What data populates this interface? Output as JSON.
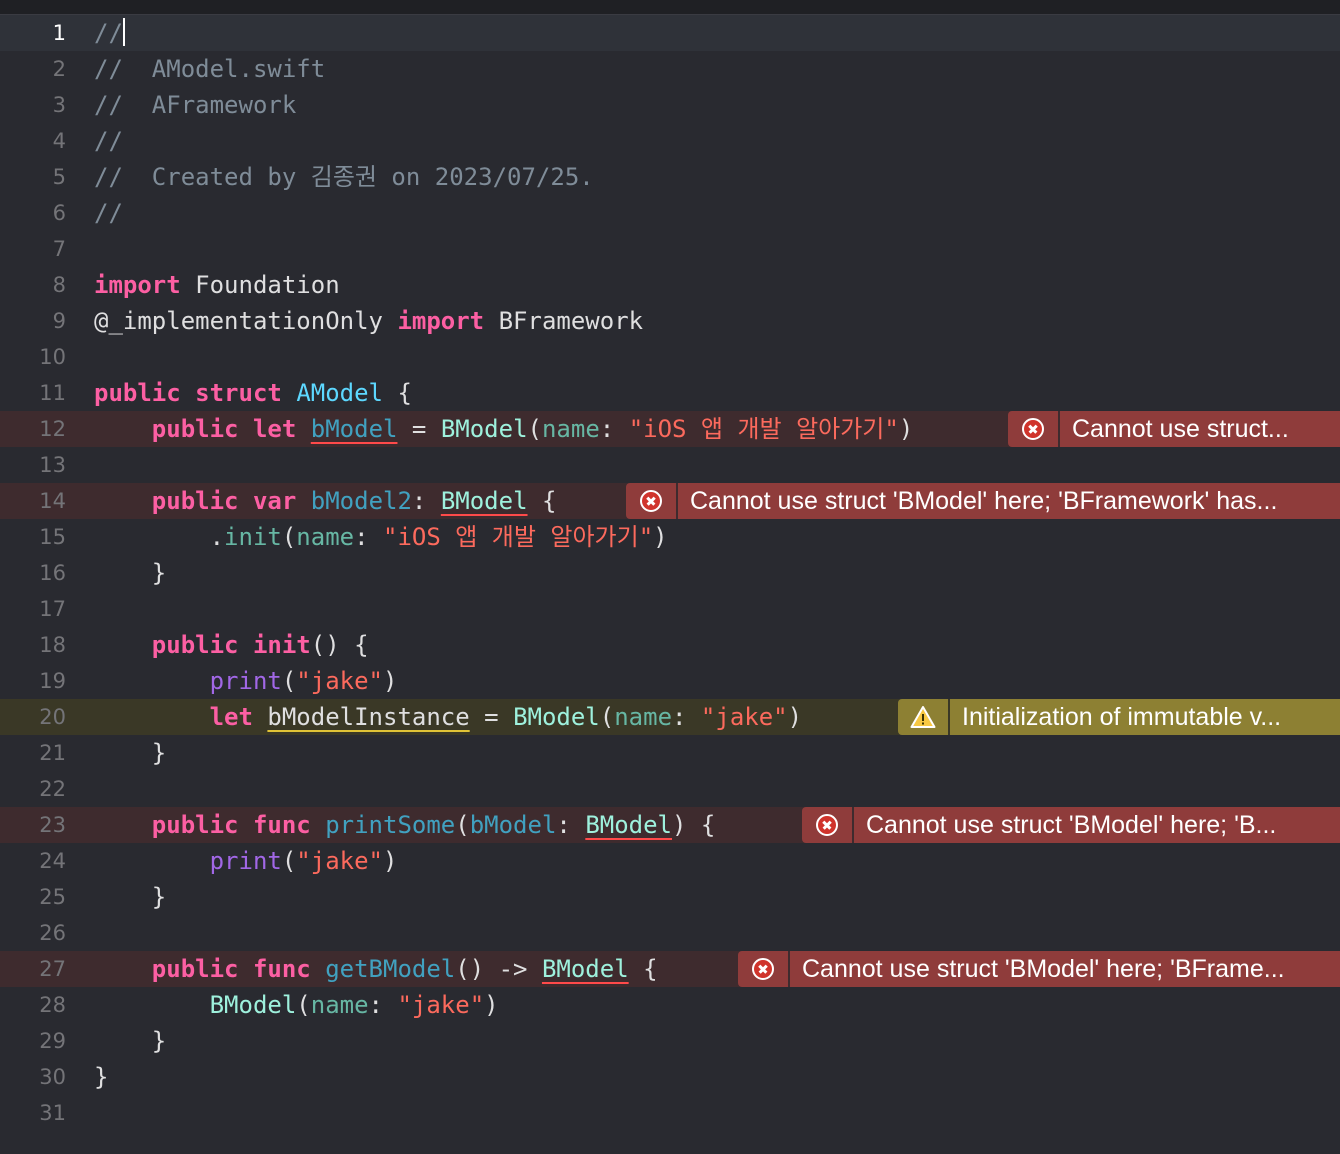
{
  "editor": {
    "current_line": 1,
    "lines": [
      {
        "n": "1"
      },
      {
        "n": "2",
        "t": "//  AModel.swift"
      },
      {
        "n": "3",
        "t": "//  AFramework"
      },
      {
        "n": "4",
        "t": "//"
      },
      {
        "n": "5",
        "t": "//  Created by 김종권 on 2023/07/25."
      },
      {
        "n": "6",
        "t": "//"
      },
      {
        "n": "7"
      },
      {
        "n": "8",
        "kw": "import",
        "mod": "Foundation"
      },
      {
        "n": "9",
        "attr": "@_implementationOnly",
        "kw": "import",
        "mod": "BFramework"
      },
      {
        "n": "10"
      },
      {
        "n": "11",
        "kw1": "public",
        "kw2": "struct",
        "type": "AModel",
        "brace": "{"
      },
      {
        "n": "12",
        "kw1": "public",
        "kw2": "let",
        "name": "bModel",
        "type": "BModel",
        "arg": "name",
        "str": "\"iOS 앱 개발 알아가기\""
      },
      {
        "n": "13"
      },
      {
        "n": "14",
        "kw1": "public",
        "kw2": "var",
        "name": "bModel2",
        "type": "BModel",
        "brace": "{"
      },
      {
        "n": "15",
        "member": "init",
        "arg": "name",
        "str": "\"iOS 앱 개발 알아가기\""
      },
      {
        "n": "16",
        "t": "}"
      },
      {
        "n": "17"
      },
      {
        "n": "18",
        "kw1": "public",
        "kw2": "init",
        "rest": "() {"
      },
      {
        "n": "19",
        "fn": "print",
        "str": "\"jake\""
      },
      {
        "n": "20",
        "kw": "let",
        "name": "bModelInstance",
        "type": "BModel",
        "arg": "name",
        "str": "\"jake\""
      },
      {
        "n": "21",
        "t": "}"
      },
      {
        "n": "22"
      },
      {
        "n": "23",
        "kw1": "public",
        "kw2": "func",
        "fname": "printSome",
        "param": "bModel",
        "type": "BModel",
        "rest": ") {"
      },
      {
        "n": "24",
        "fn": "print",
        "str": "\"jake\""
      },
      {
        "n": "25",
        "t": "}"
      },
      {
        "n": "26"
      },
      {
        "n": "27",
        "kw1": "public",
        "kw2": "func",
        "fname": "getBModel",
        "arrow": "() ->",
        "type": "BModel",
        "brace": "{"
      },
      {
        "n": "28",
        "type": "BModel",
        "arg": "name",
        "str": "\"jake\""
      },
      {
        "n": "29",
        "t": "}"
      },
      {
        "n": "30",
        "t": "}"
      },
      {
        "n": "31"
      }
    ]
  },
  "issues": [
    {
      "line": "12",
      "kind": "error",
      "icon": "error-circle-icon",
      "message": "Cannot use struct..."
    },
    {
      "line": "14",
      "kind": "error",
      "icon": "error-circle-icon",
      "message": "Cannot use struct 'BModel' here; 'BFramework' has..."
    },
    {
      "line": "20",
      "kind": "warning",
      "icon": "warning-triangle-icon",
      "message": "Initialization of immutable v..."
    },
    {
      "line": "23",
      "kind": "error",
      "icon": "error-circle-icon",
      "message": "Cannot use struct 'BModel' here; 'B..."
    },
    {
      "line": "27",
      "kind": "error",
      "icon": "error-circle-icon",
      "message": "Cannot use struct 'BModel' here; 'BFrame..."
    }
  ],
  "colors": {
    "background": "#292a30",
    "keyword": "#fc5fa3",
    "type": "#5dd8ff",
    "other_type": "#9ef1dd",
    "function": "#67b7a4",
    "declaration": "#41a1c0",
    "builtin": "#a167e6",
    "string": "#fc6a5d",
    "comment": "#7f8c98",
    "error_badge": "#8f3c3b",
    "warning_badge": "#8d8033"
  }
}
